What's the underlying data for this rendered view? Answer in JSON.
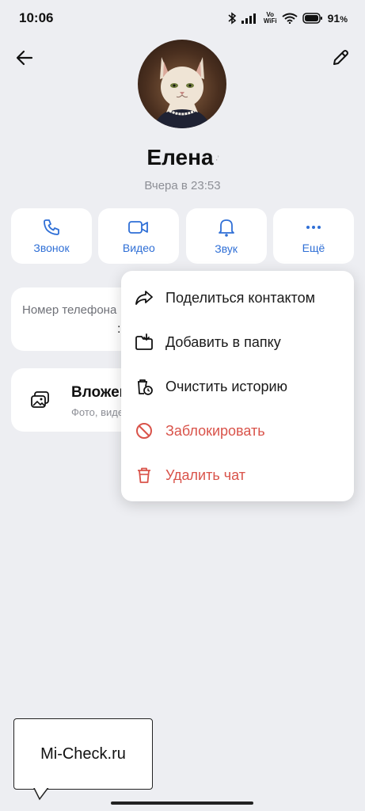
{
  "status_bar": {
    "time": "10:06",
    "volte_top": "Vo",
    "volte_bottom": "WiFi",
    "battery": "91",
    "battery_unit": "%"
  },
  "contact": {
    "name": "Елена",
    "name_suffix": "·͗",
    "last_seen": "Вчера в 23:53"
  },
  "actions": [
    {
      "label": "Звонок",
      "icon": "phone-icon"
    },
    {
      "label": "Видео",
      "icon": "video-icon"
    },
    {
      "label": "Звук",
      "icon": "bell-icon"
    },
    {
      "label": "Ещё",
      "icon": "more-icon"
    }
  ],
  "phone_card": {
    "label": "Номер телефона",
    "value": ":"
  },
  "attachments_card": {
    "title": "Вложения",
    "subtitle": "Фото, видео"
  },
  "menu": {
    "items": [
      {
        "label": "Поделиться контактом",
        "icon": "share-icon",
        "danger": false
      },
      {
        "label": "Добавить в папку",
        "icon": "add-folder-icon",
        "danger": false
      },
      {
        "label": "Очистить историю",
        "icon": "clear-history-icon",
        "danger": false
      },
      {
        "label": "Заблокировать",
        "icon": "block-icon",
        "danger": true
      },
      {
        "label": "Удалить чат",
        "icon": "trash-icon",
        "danger": true
      }
    ]
  },
  "colors": {
    "accent": "#2f6fd6",
    "danger": "#d9534a",
    "background": "#edeef2"
  },
  "watermark": {
    "text": "Mi-Check.ru"
  }
}
